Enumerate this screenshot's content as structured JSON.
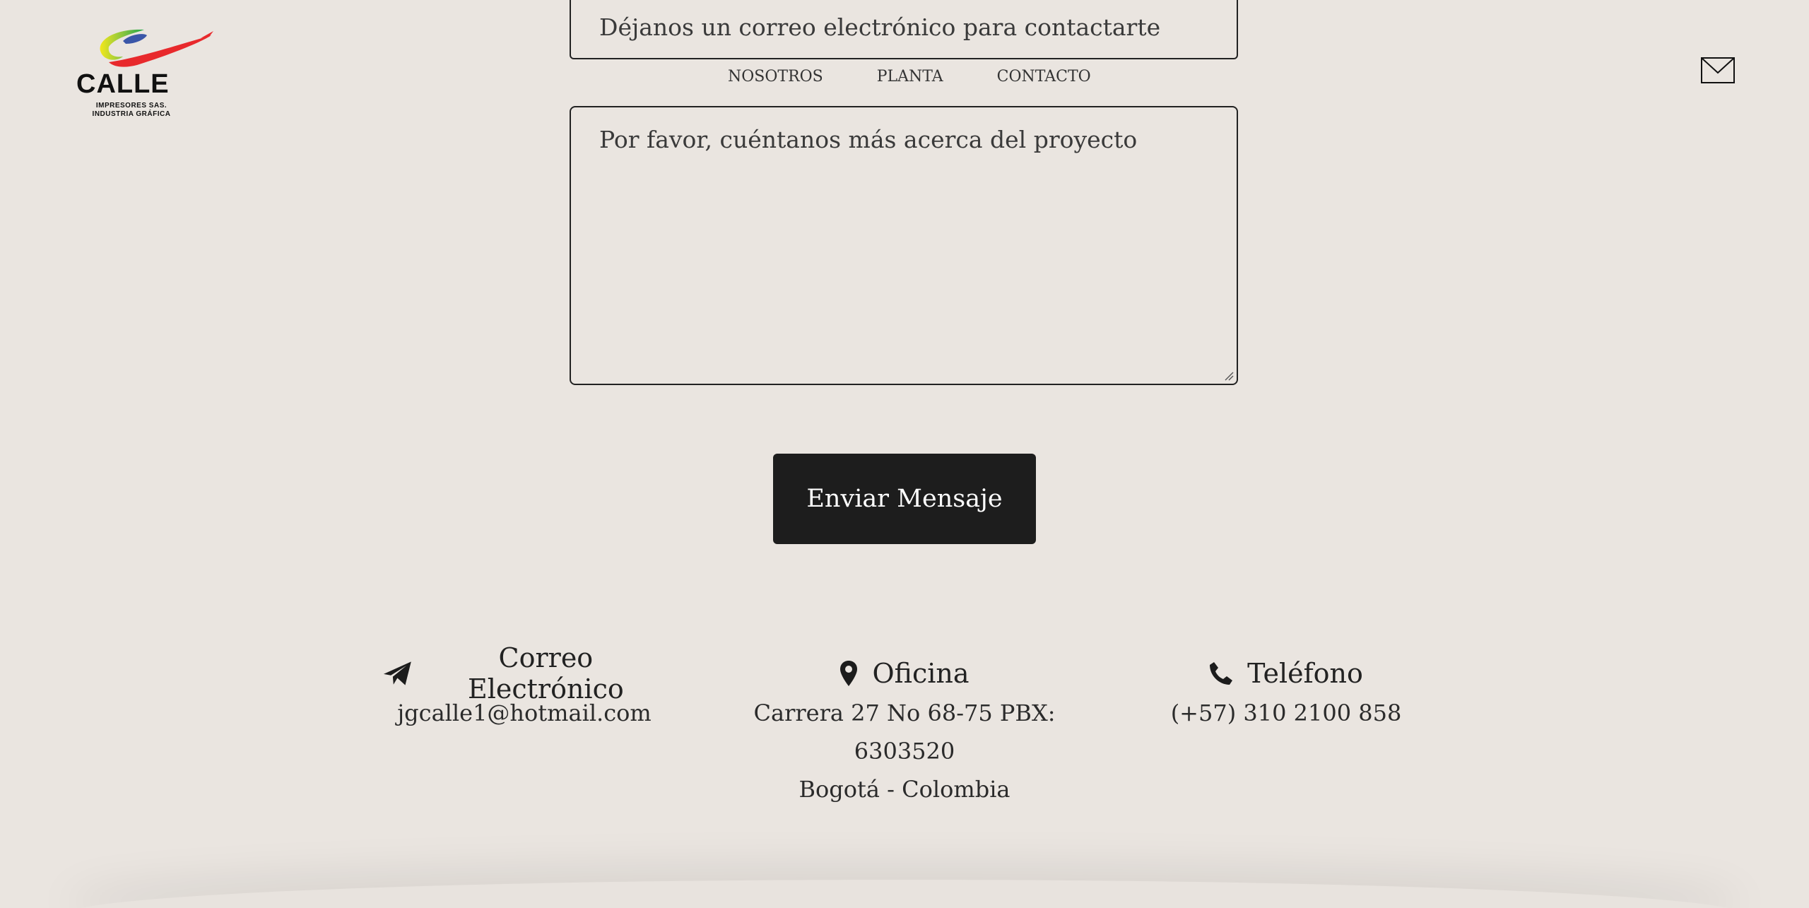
{
  "brand": {
    "name": "CALLE",
    "sub_line_1": "IMPRESORES SAS.",
    "sub_line_2": "INDUSTRIA GRÁFICA"
  },
  "header": {
    "mail_icon": "envelope-icon"
  },
  "nav": {
    "items": [
      {
        "label": "NOSOTROS"
      },
      {
        "label": "PLANTA"
      },
      {
        "label": "CONTACTO"
      }
    ]
  },
  "form": {
    "email_placeholder": "Déjanos un correo electrónico para contactarte",
    "message_placeholder": "Por favor, cuéntanos más acerca del proyecto",
    "submit_label": "Enviar Mensaje"
  },
  "contact": {
    "email": {
      "icon": "paper-plane-icon",
      "title": "Correo Electrónico",
      "value": "jgcalle1@hotmail.com"
    },
    "office": {
      "icon": "map-pin-icon",
      "title": "Oficina",
      "line_1": "Carrera 27 No 68-75 PBX: 6303520",
      "line_2": "Bogotá - Colombia"
    },
    "phone": {
      "icon": "phone-icon",
      "title": "Teléfono",
      "value": "(+57) 310 2100 858"
    }
  },
  "colors": {
    "background": "#eae5e0",
    "button": "#1d1d1d",
    "text": "#2a2a2a"
  }
}
